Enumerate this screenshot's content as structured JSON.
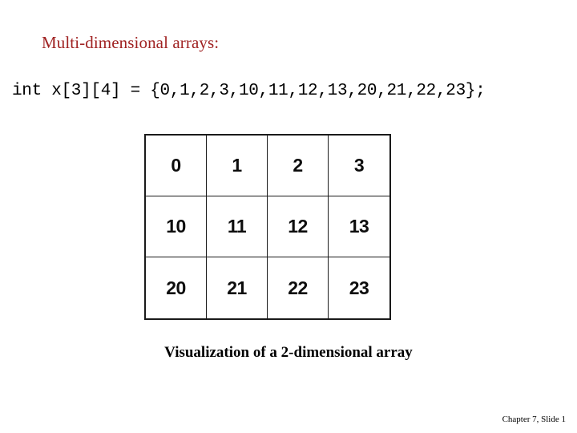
{
  "slide": {
    "title": "Multi-dimensional arrays:",
    "title_color": "#a02323",
    "code_line": "int x[3][4] = {0,1,2,3,10,11,12,13,20,21,22,23};",
    "caption": "Visualization of a 2-dimensional array",
    "footer": "Chapter 7, Slide 1",
    "background_color": "#ffffff"
  },
  "array_table": {
    "rows": 3,
    "columns": 4,
    "border_color": "#1a1a1a",
    "cells": [
      [
        "0",
        "1",
        "2",
        "3"
      ],
      [
        "10",
        "11",
        "12",
        "13"
      ],
      [
        "20",
        "21",
        "22",
        "23"
      ]
    ]
  }
}
